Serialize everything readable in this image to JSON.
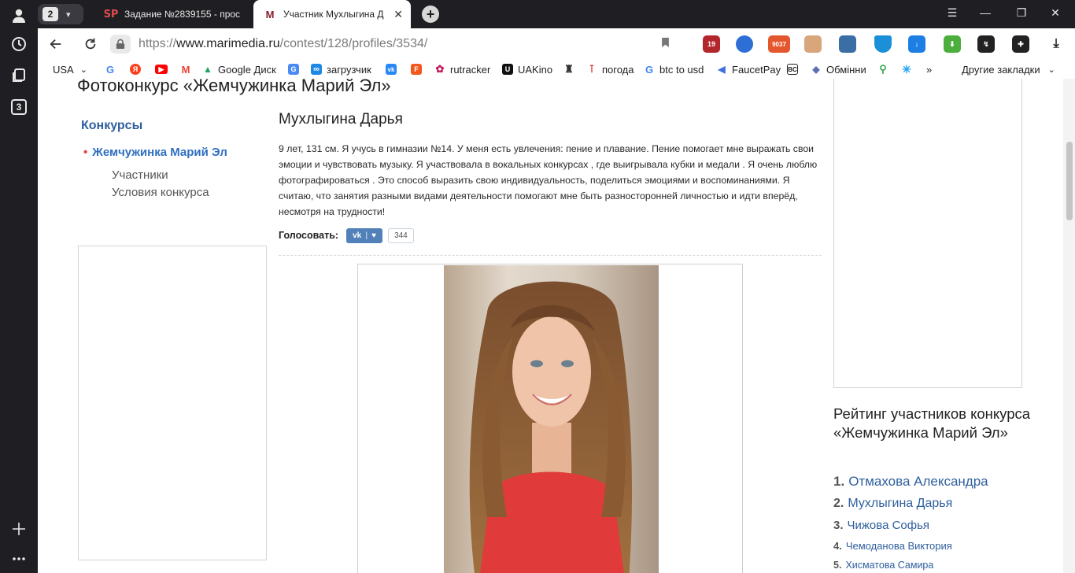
{
  "browser": {
    "tab_count": "2",
    "tabs": [
      {
        "favicon_text": "SP",
        "title": "Задание №2839155 - прос"
      },
      {
        "favicon_text": "M",
        "title": "Участник Мухлыгина Д",
        "close": "✕"
      }
    ],
    "new_tab": "+",
    "address": {
      "proto": "https://",
      "host": "www.marimedia.ru",
      "path": "/contest/128/profiles/3534/"
    },
    "extensions": [
      {
        "name": "extension-badge-19",
        "label": "19",
        "color": "#b3262b"
      },
      {
        "name": "extension-vpn",
        "label": "",
        "color": "#2e6fd6"
      },
      {
        "name": "extension-counter-9037",
        "label": "9037",
        "color": "#e4572e"
      },
      {
        "name": "extension-cat",
        "label": "",
        "color": "#d9a57a"
      },
      {
        "name": "extension-archive",
        "label": "",
        "color": "#3b6ea5"
      },
      {
        "name": "extension-diamond",
        "label": "",
        "color": "#1b8fd8"
      },
      {
        "name": "extension-download-blue",
        "label": "",
        "color": "#1d7ee3"
      },
      {
        "name": "extension-download-green",
        "label": "",
        "color": "#4caf3d"
      },
      {
        "name": "extension-tool",
        "label": "",
        "color": "#222222"
      },
      {
        "name": "extension-puzzle",
        "label": "",
        "color": "#222222"
      },
      {
        "name": "extension-download-arrow",
        "label": "",
        "color": "#222222"
      }
    ],
    "bookmarks": [
      {
        "label": "USA",
        "icon_text": "",
        "color": "#ffffff",
        "suffix": "⌄"
      },
      {
        "label": "",
        "icon_text": "G",
        "color": "#4285f4"
      },
      {
        "label": "",
        "icon_text": "Я",
        "color": "#fc3f1d"
      },
      {
        "label": "",
        "icon_text": "▶",
        "color": "#ff0000"
      },
      {
        "label": "",
        "icon_text": "M",
        "color": "#ea4335"
      },
      {
        "label": "Google Диск",
        "icon_text": "▲",
        "color": "#1fa463"
      },
      {
        "label": "",
        "icon_text": "G",
        "color": "#4a8af4"
      },
      {
        "label": "загрузчик",
        "icon_text": "∞",
        "color": "#1e88e5"
      },
      {
        "label": "",
        "icon_text": "vk",
        "color": "#2787f5"
      },
      {
        "label": "",
        "icon_text": "F",
        "color": "#f2571b"
      },
      {
        "label": "rutracker",
        "icon_text": "✿",
        "color": "#c2185b"
      },
      {
        "label": "UAKino",
        "icon_text": "U",
        "color": "#111111"
      },
      {
        "label": "",
        "icon_text": "♜",
        "color": "#333333"
      },
      {
        "label": "погода",
        "icon_text": "🌡",
        "color": "#ffffff"
      },
      {
        "label": "btc to usd",
        "icon_text": "G",
        "color": "#4285f4"
      },
      {
        "label": "FaucetPay",
        "icon_text": "◀",
        "color": "#3f6fe0"
      },
      {
        "label": "",
        "icon_text": "BC",
        "color": "#222222"
      },
      {
        "label": "Обмінни",
        "icon_text": "◆",
        "color": "#5b6fb3"
      },
      {
        "label": "",
        "icon_text": "📍",
        "color": "#ffffff"
      },
      {
        "label": "",
        "icon_text": "✳",
        "color": "#ffffff"
      }
    ],
    "bookmarks_more": "»",
    "other_bookmarks": "Другие закладки"
  },
  "site": {
    "title": "Фотоконкурс «Жемчужинка Марий Эл»"
  },
  "sidebar": {
    "heading": "Конкурсы",
    "active_item": "Жемчужинка Марий Эл",
    "sub_items": [
      "Участники",
      "Условия конкурса"
    ]
  },
  "profile": {
    "name": "Мухлыгина Дарья",
    "bio": "9 лет, 131 см. Я учусь в гимназии №14. У меня есть увлечения: пение и плавание. Пение помогает мне выражать свои эмоции и чувствовать музыку. Я участвовала в вокальных конкурсах , где выигрывала кубки и медали . Я очень люблю фотографироваться . Это способ выразить свою индивидуальность, поделиться эмоциями и воспоминаниями. Я считаю, что занятия разными видами деятельности помогают мне быть разносторонней личностью и идти вперёд, несмотря на трудности!",
    "vote_label": "Голосовать:",
    "vote_count": "344"
  },
  "rating": {
    "title": "Рейтинг участников конкурса «Жемчужинка Марий Эл»",
    "items": [
      {
        "num": "1.",
        "name": "Отмахова Александра"
      },
      {
        "num": "2.",
        "name": "Мухлыгина Дарья"
      },
      {
        "num": "3.",
        "name": "Чижова Софья"
      },
      {
        "num": "4.",
        "name": "Чемоданова Виктория"
      },
      {
        "num": "5.",
        "name": "Хисматова Самира"
      }
    ]
  }
}
